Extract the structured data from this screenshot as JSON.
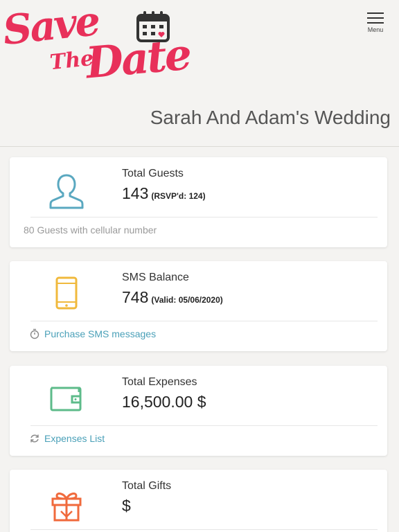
{
  "header": {
    "logo_text": [
      "Save",
      "The",
      "Date"
    ],
    "menu_label": "Menu",
    "page_title": "Sarah And Adam's Wedding"
  },
  "cards": [
    {
      "label": "Total Guests",
      "value": "143",
      "sub": "(RSVP'd: 124)",
      "footer": "80 Guests with cellular number",
      "icon": "user-icon",
      "color": "#5aa8c0"
    },
    {
      "label": "SMS Balance",
      "value": "748",
      "sub": "(Valid: 05/06/2020)",
      "footer": "Purchase SMS messages",
      "icon": "phone-icon",
      "color": "#f0b93c"
    },
    {
      "label": "Total Expenses",
      "value": "16,500.00 $",
      "sub": "",
      "footer": "Expenses List",
      "icon": "wallet-icon",
      "color": "#5dbb8a"
    },
    {
      "label": "Total Gifts",
      "value": "$",
      "sub": "",
      "footer": "",
      "icon": "gift-icon",
      "color": "#f06a3c"
    }
  ],
  "colors": {
    "brand": "#e8305a",
    "link": "#4aa0b8",
    "background": "#f4f3f1"
  }
}
